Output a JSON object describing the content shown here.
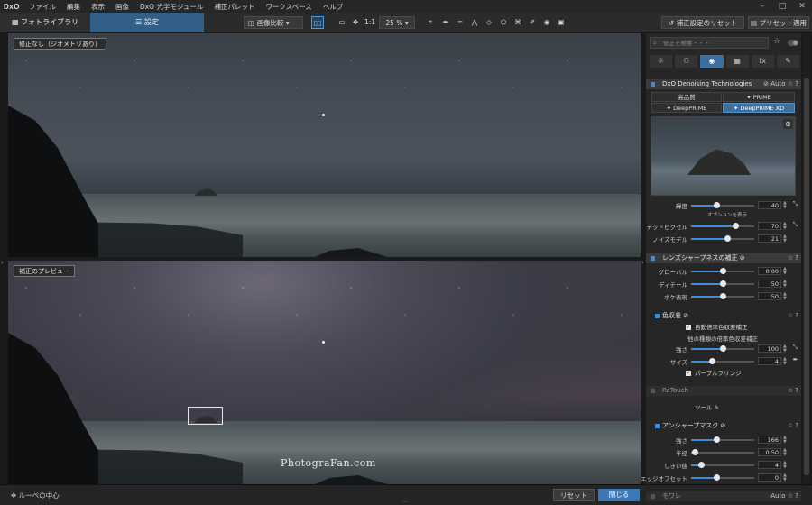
{
  "app": {
    "logo": "DxO",
    "menu": [
      "ファイル",
      "編集",
      "表示",
      "画像",
      "DxO 光学モジュール",
      "補正パレット",
      "ワークスペース",
      "ヘルプ"
    ]
  },
  "toolbar": {
    "tab_photo": "フォトライブラリ",
    "tab_edit": "設定",
    "compare": "画像比較",
    "ratio": "1:1",
    "zoom": "25 %",
    "reset_settings": "補正設定のリセット",
    "apply_preset": "プリセット適用"
  },
  "viewer": {
    "top_label": "修正なし（ジオメトリあり）",
    "bottom_label": "補正のプレビュー",
    "watermark": "PhotograFan.com"
  },
  "bottom": {
    "loupe_center": "ルーペの中心",
    "reset": "リセット",
    "close": "閉じる"
  },
  "panel": {
    "search_placeholder": "修正を検索・・・",
    "palette_icons": [
      "sun-icon",
      "color-icon",
      "detail-icon",
      "geometry-icon",
      "fx-icon",
      "local-icon"
    ],
    "palette_glyphs": [
      "☼",
      "⚇",
      "◉",
      "▦",
      "fx",
      "✎"
    ],
    "denoise": {
      "title": "DxO Denoising Technologies",
      "auto": "Auto",
      "modes": [
        "高品質",
        "PRIME",
        "DeepPRIME",
        "DeepPRIME XD"
      ],
      "luminance_label": "輝度",
      "luminance_value": "40",
      "option_note": "オプションを表示",
      "deadpixel_label": "デッドピクセル",
      "deadpixel_value": "70",
      "noise_model_label": "ノイズモデル",
      "noise_model_value": "21"
    },
    "sharpness": {
      "title": "レンズシャープネスの補正",
      "global_label": "グローバル",
      "global_value": "0.00",
      "detail_label": "ディテール",
      "detail_value": "50",
      "bokeh_label": "ボケ表現",
      "bokeh_value": "50"
    },
    "chromatic": {
      "title": "色収差",
      "auto_check": "自動倍率色収差補正",
      "other_label": "他の種類の倍率色収差補正",
      "strength_label": "強さ",
      "strength_value": "100",
      "size_label": "サイズ",
      "size_value": "4",
      "purple_check": "パープルフリンジ"
    },
    "retouch": {
      "title": "ReTouch",
      "tool_label": "ツール"
    },
    "unsharp": {
      "title": "アンシャープマスク",
      "strength_label": "強さ",
      "strength_value": "166",
      "radius_label": "半径",
      "radius_value": "0.50",
      "threshold_label": "しきい値",
      "threshold_value": "4",
      "edge_label": "エッジオフセット",
      "edge_value": "0"
    },
    "moire": {
      "title": "モワレ",
      "auto": "Auto"
    }
  }
}
